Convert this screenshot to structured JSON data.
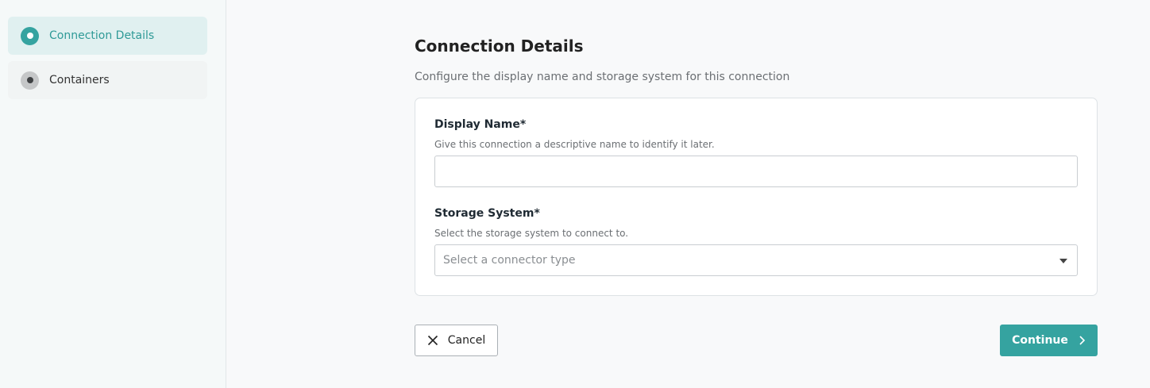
{
  "colors": {
    "accent": "#35a3a0",
    "accent_text": "#2f9a97",
    "active_step_bg": "#e0f0f0"
  },
  "sidebar": {
    "steps": [
      {
        "label": "Connection Details",
        "state": "active",
        "icon": "radio-dot-icon"
      },
      {
        "label": "Containers",
        "state": "inactive",
        "icon": "radio-dot-icon"
      }
    ]
  },
  "main": {
    "title": "Connection Details",
    "subtitle": "Configure the display name and storage system for this connection",
    "form": {
      "display_name": {
        "label": "Display Name*",
        "help": "Give this connection a descriptive name to identify it later.",
        "value": "",
        "placeholder": ""
      },
      "storage_system": {
        "label": "Storage System*",
        "help": "Select the storage system to connect to.",
        "placeholder": "Select a connector type",
        "icon": "chevron-down-icon"
      }
    }
  },
  "actions": {
    "cancel_label": "Cancel",
    "cancel_icon": "close-icon",
    "continue_label": "Continue",
    "continue_icon": "chevron-right-icon"
  }
}
